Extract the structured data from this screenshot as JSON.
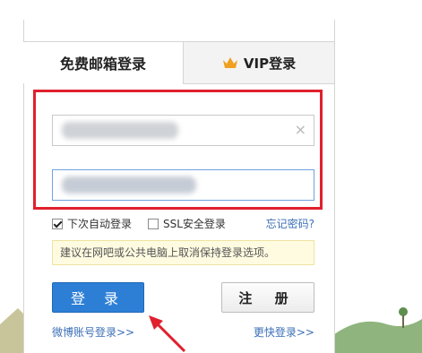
{
  "tabs": {
    "free_login": "免费邮箱登录",
    "vip_login": "VIP登录"
  },
  "form": {
    "username_value": "",
    "password_value": "",
    "clear_glyph": "×"
  },
  "options": {
    "auto_login": "下次自动登录",
    "auto_login_checked": true,
    "ssl_login": "SSL安全登录",
    "ssl_checked": false,
    "forgot_password": "忘记密码?"
  },
  "hint": "建议在网吧或公共电脑上取消保持登录选项。",
  "buttons": {
    "login": "登 录",
    "register": "注 册"
  },
  "links": {
    "weibo": "微博账号登录>>",
    "more": "更快登录>>"
  },
  "colors": {
    "highlight_frame": "#e0202d",
    "login_button": "#2d7fd6",
    "link": "#3b6fb6",
    "arrow": "#e0202d"
  }
}
